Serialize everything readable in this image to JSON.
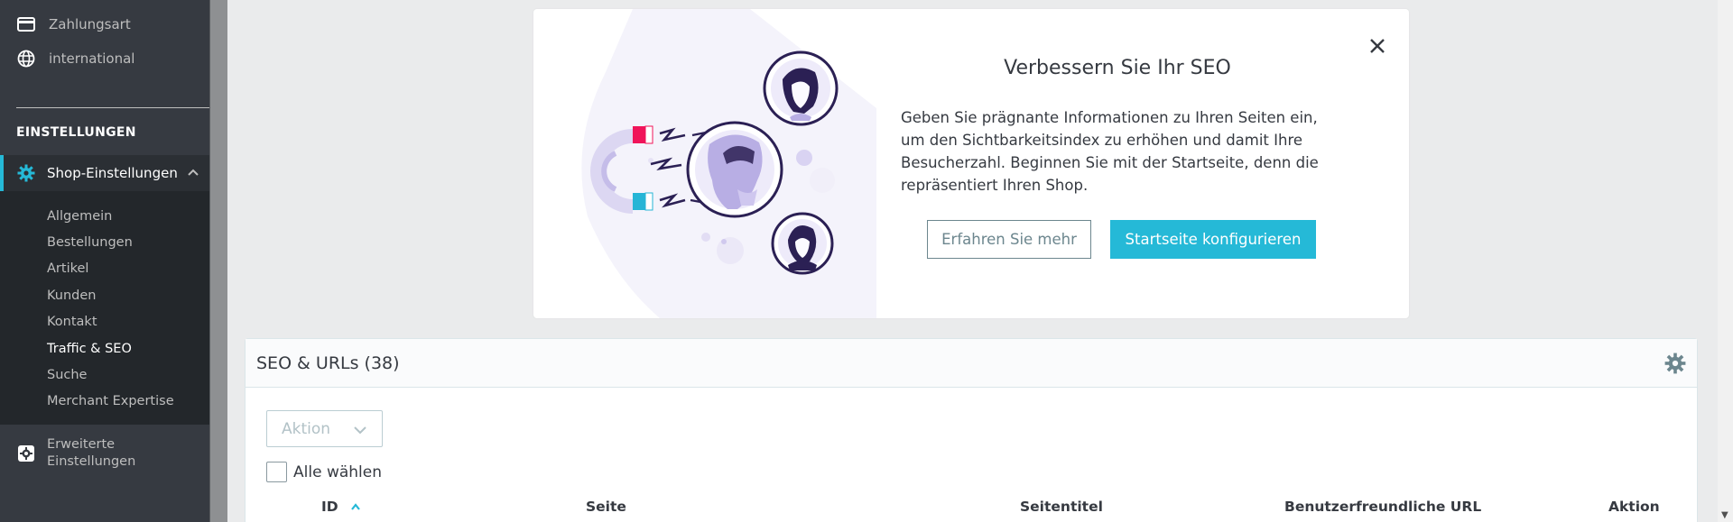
{
  "sidebar": {
    "top_items": [
      {
        "label": "Zahlungsart",
        "icon": "credit-card-icon"
      },
      {
        "label": "international",
        "icon": "globe-icon"
      }
    ],
    "section_title": "EINSTELLUNGEN",
    "active_item": {
      "label": "Shop-Einstellungen",
      "icon": "gear-icon"
    },
    "sub_items": [
      {
        "label": "Allgemein"
      },
      {
        "label": "Bestellungen"
      },
      {
        "label": "Artikel"
      },
      {
        "label": "Kunden"
      },
      {
        "label": "Kontakt"
      },
      {
        "label": "Traffic & SEO"
      },
      {
        "label": "Suche"
      },
      {
        "label": "Merchant Expertise"
      }
    ],
    "advanced": {
      "label": "Erweiterte Einstellungen",
      "icon": "settings-box-icon"
    }
  },
  "seo_card": {
    "title": "Verbessern Sie Ihr SEO",
    "description": "Geben Sie prägnante Informationen zu Ihren Seiten ein, um den Sichtbarkeitsindex zu erhöhen und damit Ihre Besucherzahl. Beginnen Sie mit der Startseite, denn die repräsentiert Ihren Shop.",
    "learn_more": "Erfahren Sie mehr",
    "configure": "Startseite konfigurieren"
  },
  "panel": {
    "title": "SEO & URLs (38)",
    "bulk_action": "Aktion",
    "select_all": "Alle wählen",
    "columns": [
      "ID",
      "Seite",
      "Seitentitel",
      "Benutzerfreundliche URL",
      "Aktion"
    ]
  },
  "colors": {
    "accent": "#25b9d7",
    "sidebar_bg": "#363a41",
    "illustration_purple": "#2b2054",
    "magnet_pink": "#f0145a"
  }
}
